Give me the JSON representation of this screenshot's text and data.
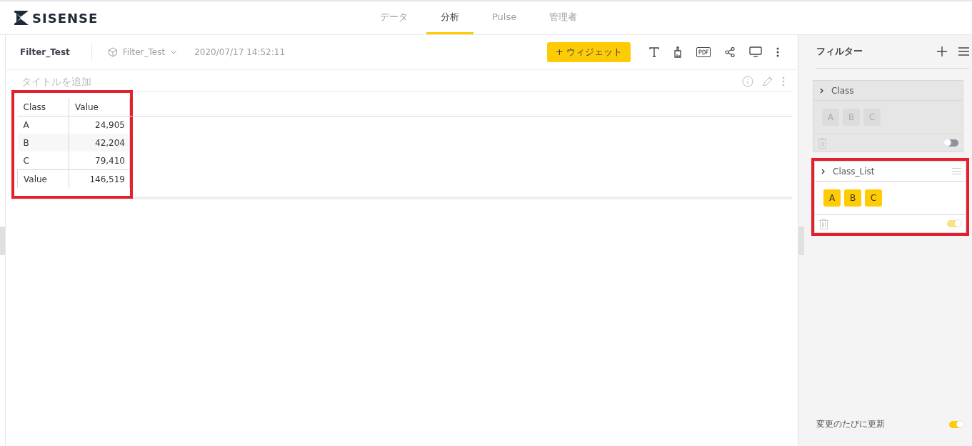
{
  "brand": {
    "name": "SISENSE"
  },
  "nav_tabs": [
    {
      "label": "データ",
      "selected": false
    },
    {
      "label": "分析",
      "selected": true
    },
    {
      "label": "Pulse",
      "selected": false
    },
    {
      "label": "管理者",
      "selected": false
    }
  ],
  "toolbar": {
    "dashboard_title": "Filter_Test",
    "datasource": "Filter_Test",
    "timestamp": "2020/07/17 14:52:11",
    "add_widget": "+ ウィジェット"
  },
  "widget": {
    "title_placeholder": "タイトルを追加",
    "highlighted": true,
    "table": {
      "columns": [
        "Class",
        "Value"
      ],
      "rows": [
        [
          "A",
          "24,905"
        ],
        [
          "B",
          "42,204"
        ],
        [
          "C",
          "79,410"
        ]
      ],
      "total": [
        "Value",
        "146,519"
      ]
    }
  },
  "filter_panel": {
    "title": "フィルター",
    "filters": [
      {
        "name": "Class",
        "enabled": false,
        "highlighted": false,
        "members": [
          "A",
          "B",
          "C"
        ]
      },
      {
        "name": "Class_List",
        "enabled": true,
        "highlighted": true,
        "members": [
          "A",
          "B",
          "C"
        ]
      }
    ],
    "auto_update": {
      "label": "変更のたびに更新",
      "on": true
    }
  }
}
